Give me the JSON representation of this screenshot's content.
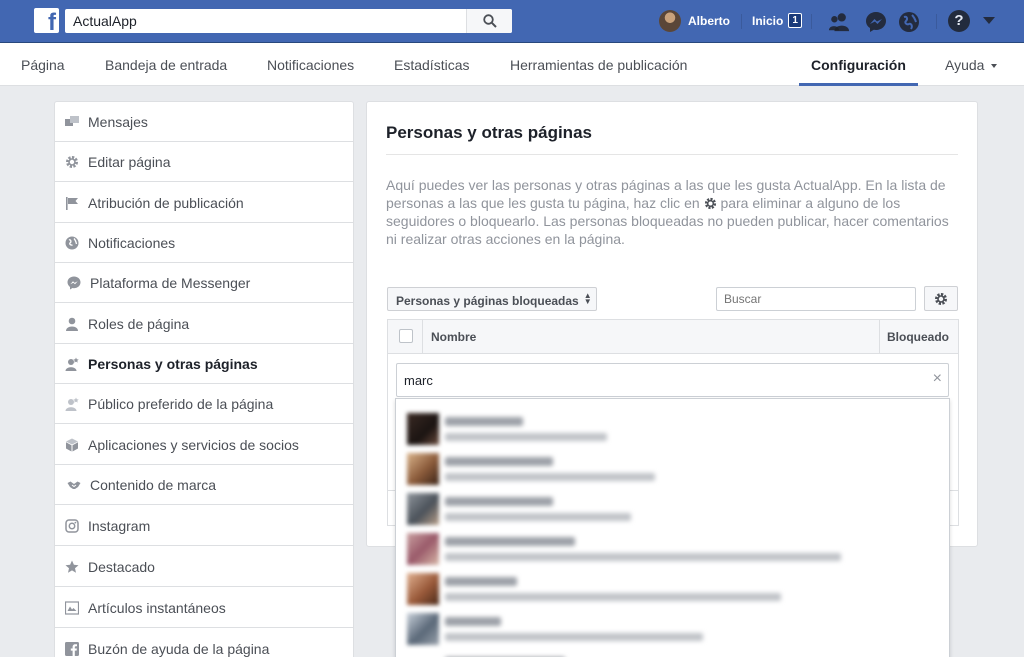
{
  "topbar": {
    "search_value": "ActualApp",
    "user_name": "Alberto",
    "home_label": "Inicio",
    "home_count": "1",
    "icons": [
      "facebook-logo",
      "search-icon",
      "friends-icon",
      "messenger-icon",
      "globe-icon",
      "help-icon",
      "account-caret-icon"
    ]
  },
  "nav": {
    "items": [
      {
        "label": "Página"
      },
      {
        "label": "Bandeja de entrada"
      },
      {
        "label": "Notificaciones"
      },
      {
        "label": "Estadísticas"
      },
      {
        "label": "Herramientas de publicación"
      },
      {
        "label": "Configuración",
        "active": true
      },
      {
        "label": "Ayuda"
      }
    ]
  },
  "sidebar": {
    "items": [
      {
        "label": "Mensajes",
        "icon": "messages-icon"
      },
      {
        "label": "Editar página",
        "icon": "gear-icon"
      },
      {
        "label": "Atribución de publicación",
        "icon": "flag-icon"
      },
      {
        "label": "Notificaciones",
        "icon": "globe-icon"
      },
      {
        "label": "Plataforma de Messenger",
        "icon": "messenger-icon"
      },
      {
        "label": "Roles de página",
        "icon": "person-icon"
      },
      {
        "label": "Personas y otras páginas",
        "icon": "person-star-icon",
        "active": true
      },
      {
        "label": "Público preferido de la página",
        "icon": "person-star-icon"
      },
      {
        "label": "Aplicaciones y servicios de socios",
        "icon": "cube-icon"
      },
      {
        "label": "Contenido de marca",
        "icon": "handshake-icon"
      },
      {
        "label": "Instagram",
        "icon": "instagram-icon"
      },
      {
        "label": "Destacado",
        "icon": "star-icon"
      },
      {
        "label": "Artículos instantáneos",
        "icon": "article-icon"
      },
      {
        "label": "Buzón de ayuda de la página",
        "icon": "facebook-icon"
      }
    ]
  },
  "main": {
    "title": "Personas y otras páginas",
    "description_part1": "Aquí puedes ver las personas y otras páginas a las que les gusta ActualApp. En la lista de personas a las que les gusta tu página, haz clic en",
    "description_part2": "para eliminar a alguno de los seguidores o bloquearlo. Las personas bloqueadas no pueden publicar, hacer comentarios ni realizar otras acciones en la página.",
    "filter_select": "Personas y páginas bloqueadas",
    "search_placeholder": "Buscar",
    "table": {
      "col_name": "Nombre",
      "col_blocked": "Bloqueado"
    },
    "typeahead_value": "marc",
    "clear_symbol": "×"
  },
  "colors": {
    "brand_blue": "#4267b2",
    "page_bg": "#e9ebee"
  }
}
